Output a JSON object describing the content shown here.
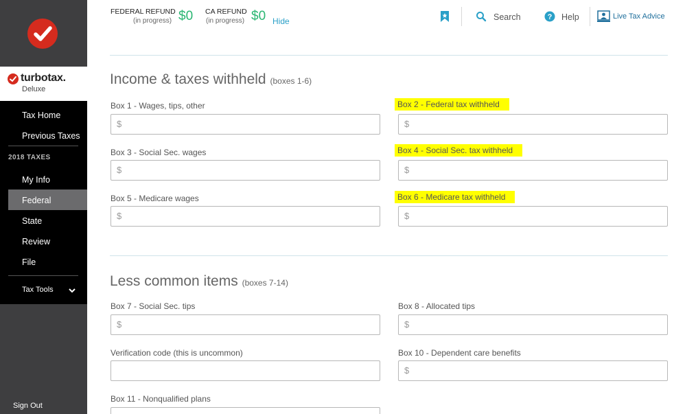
{
  "header": {
    "federal_label": "FEDERAL REFUND",
    "federal_status": "(in progress)",
    "federal_amount": "$0",
    "ca_label": "CA REFUND",
    "ca_status": "(in progress)",
    "ca_amount": "$0",
    "hide_link": "Hide",
    "search_label": "Search",
    "help_label": "Help",
    "live_advice_label": "Live Tax Advice"
  },
  "brand": {
    "name": "turbotax.",
    "edition": "Deluxe"
  },
  "sidebar": {
    "top_items": [
      "Tax Home",
      "Previous Taxes"
    ],
    "section_label": "2018 TAXES",
    "items": [
      "My Info",
      "Federal",
      "State",
      "Review",
      "File"
    ],
    "active_item": "Federal",
    "tools_label": "Tax Tools",
    "sign_out": "Sign Out"
  },
  "sections": {
    "income": {
      "title": "Income & taxes withheld",
      "subtitle": "(boxes 1-6)"
    },
    "less_common": {
      "title": "Less common items",
      "subtitle": "(boxes 7-14)"
    }
  },
  "fields": {
    "box1": {
      "label": "Box 1 - Wages, tips, other",
      "placeholder": "$"
    },
    "box2": {
      "label": "Box 2 - Federal tax withheld",
      "placeholder": "$",
      "highlighted": true
    },
    "box3": {
      "label": "Box 3 - Social Sec. wages",
      "placeholder": "$"
    },
    "box4": {
      "label": "Box 4 - Social Sec. tax withheld",
      "placeholder": "$",
      "highlighted": true
    },
    "box5": {
      "label": "Box 5 - Medicare wages",
      "placeholder": "$"
    },
    "box6": {
      "label": "Box 6 - Medicare tax withheld",
      "placeholder": "$",
      "highlighted": true
    },
    "box7": {
      "label": "Box 7 - Social Sec. tips",
      "placeholder": "$"
    },
    "box8": {
      "label": "Box 8 - Allocated tips",
      "placeholder": "$"
    },
    "verification": {
      "label": "Verification code (this is uncommon)",
      "placeholder": ""
    },
    "box10": {
      "label": "Box 10 - Dependent care benefits",
      "placeholder": "$"
    },
    "box11": {
      "label": "Box 11 - Nonqualified plans",
      "placeholder": ""
    }
  },
  "colors": {
    "brand_red": "#d52b1e",
    "refund_green": "#2bb673",
    "link_blue": "#2aa0c8",
    "highlight_yellow": "#ffff00",
    "sidebar_black": "#000000",
    "sidebar_gray": "#3e3e40"
  },
  "icons": {
    "bookmark": "bookmark-icon",
    "search": "search-icon",
    "help": "help-icon",
    "live_advice": "person-screen-icon",
    "chevron": "chevron-down-icon",
    "logo": "checkmark-icon"
  }
}
